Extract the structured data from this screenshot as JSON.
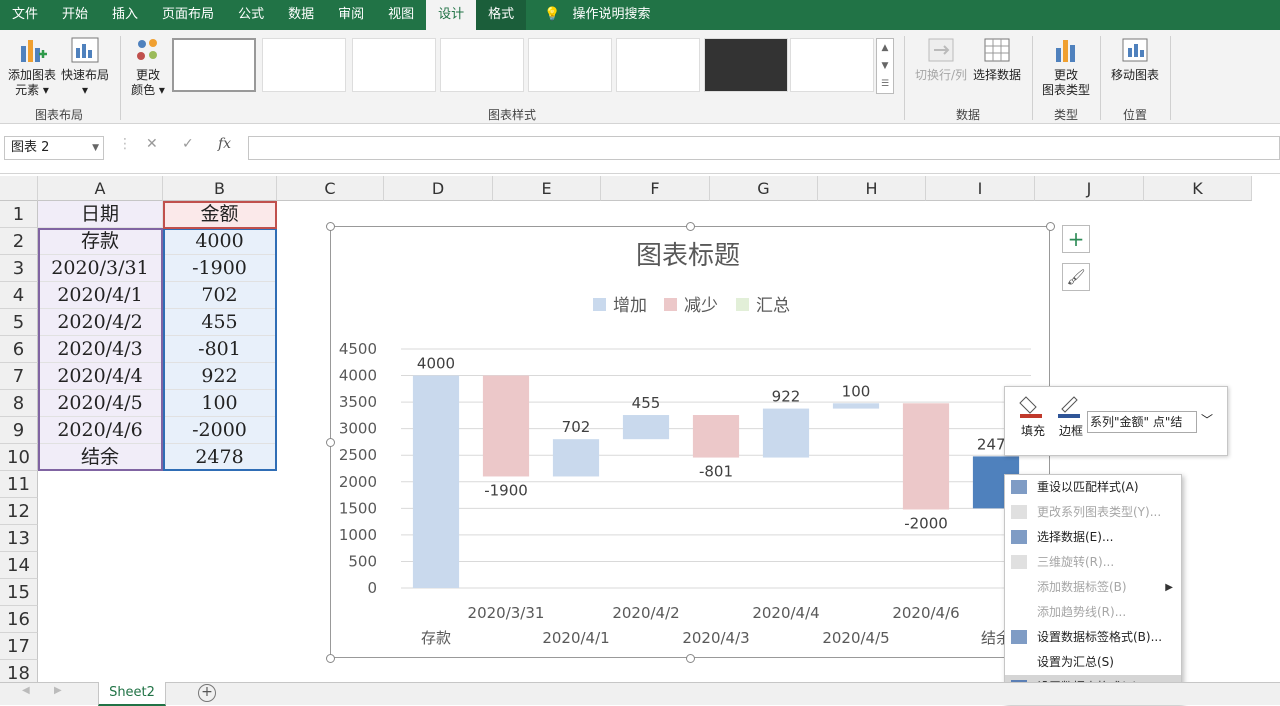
{
  "tabs": [
    "文件",
    "开始",
    "插入",
    "页面布局",
    "公式",
    "数据",
    "审阅",
    "视图",
    "设计",
    "格式"
  ],
  "tell_me": "操作说明搜索",
  "ribbon": {
    "add_element": "添加图表",
    "add_element_2": "元素",
    "quick_layout": "快速布局",
    "change_color": "更改",
    "change_color_2": "颜色",
    "group_layout": "图表布局",
    "group_styles": "图表样式",
    "switch_row_col": "切换行/列",
    "select_data": "选择数据",
    "group_data": "数据",
    "change_type": "更改",
    "change_type_2": "图表类型",
    "group_type": "类型",
    "move_chart": "移动图表",
    "group_location": "位置"
  },
  "namebox": "图表 2",
  "columns": [
    "A",
    "B",
    "C",
    "D",
    "E",
    "F",
    "G",
    "H",
    "I",
    "J",
    "K"
  ],
  "rows": [
    "1",
    "2",
    "3",
    "4",
    "5",
    "6",
    "7",
    "8",
    "9",
    "10",
    "11",
    "12",
    "13",
    "14",
    "15",
    "16",
    "17",
    "18"
  ],
  "table": [
    [
      "日期",
      "金额"
    ],
    [
      "存款",
      "4000"
    ],
    [
      "2020/3/31",
      "-1900"
    ],
    [
      "2020/4/1",
      "702"
    ],
    [
      "2020/4/2",
      "455"
    ],
    [
      "2020/4/3",
      "-801"
    ],
    [
      "2020/4/4",
      "922"
    ],
    [
      "2020/4/5",
      "100"
    ],
    [
      "2020/4/6",
      "-2000"
    ],
    [
      "结余",
      "2478"
    ]
  ],
  "chart_data": {
    "type": "bar",
    "subtype": "waterfall",
    "title": "图表标题",
    "legend": [
      "增加",
      "减少",
      "汇总"
    ],
    "legend_position": "top",
    "categories": [
      "存款",
      "2020/3/31",
      "2020/4/1",
      "2020/4/2",
      "2020/4/3",
      "2020/4/4",
      "2020/4/5",
      "2020/4/6",
      "结余"
    ],
    "values": [
      4000,
      -1900,
      702,
      455,
      -801,
      922,
      100,
      -2000,
      2478
    ],
    "labels": [
      "4000",
      "-1900",
      "702",
      "455",
      "-801",
      "922",
      "100",
      "-2000",
      "2478"
    ],
    "kinds": [
      "total",
      "decrease",
      "increase",
      "increase",
      "decrease",
      "increase",
      "increase",
      "decrease",
      "total"
    ],
    "ylim": [
      0,
      4500
    ],
    "yticks": [
      "0",
      "500",
      "1000",
      "1500",
      "2000",
      "2500",
      "3000",
      "3500",
      "4000",
      "4500"
    ],
    "colors": {
      "increase": "#c9d9ed",
      "decrease": "#ecc8c9",
      "total_legend": "#e2efd8",
      "selected": "#4f81bd"
    },
    "grid": true
  },
  "minibar": {
    "fill": "填充",
    "border": "边框",
    "series_select": "系列\"金额\" 点\"结"
  },
  "context_menu": [
    {
      "label": "重设以匹配样式(A)",
      "disabled": false
    },
    {
      "label": "更改系列图表类型(Y)...",
      "disabled": true
    },
    {
      "label": "选择数据(E)...",
      "disabled": false
    },
    {
      "label": "三维旋转(R)...",
      "disabled": true
    },
    {
      "label": "添加数据标签(B)",
      "disabled": true
    },
    {
      "label": "添加趋势线(R)...",
      "disabled": true
    },
    {
      "label": "设置数据标签格式(B)...",
      "disabled": false
    },
    {
      "label": "设置为汇总(S)",
      "disabled": false
    },
    {
      "label": "设置数据点格式(F)...",
      "disabled": false
    }
  ],
  "sheet_tab": "Sheet2"
}
